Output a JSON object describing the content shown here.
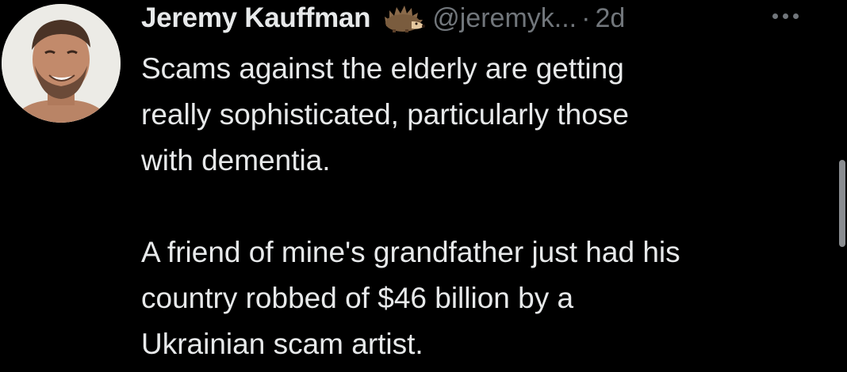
{
  "tweet": {
    "display_name": "Jeremy Kauffman",
    "emoji": "hedgehog-emoji",
    "handle": "@jeremyk...",
    "separator": "·",
    "time": "2d",
    "paragraph1": [
      "Scams against the elderly are getting",
      "really sophisticated, particularly those",
      "with dementia."
    ],
    "paragraph2": [
      "A friend of mine's grandfather just had his",
      "country robbed of $46 billion by a",
      "Ukrainian scam artist."
    ]
  },
  "colors": {
    "background": "#000000",
    "text": "#e7e9ea",
    "secondary": "#71767b"
  }
}
